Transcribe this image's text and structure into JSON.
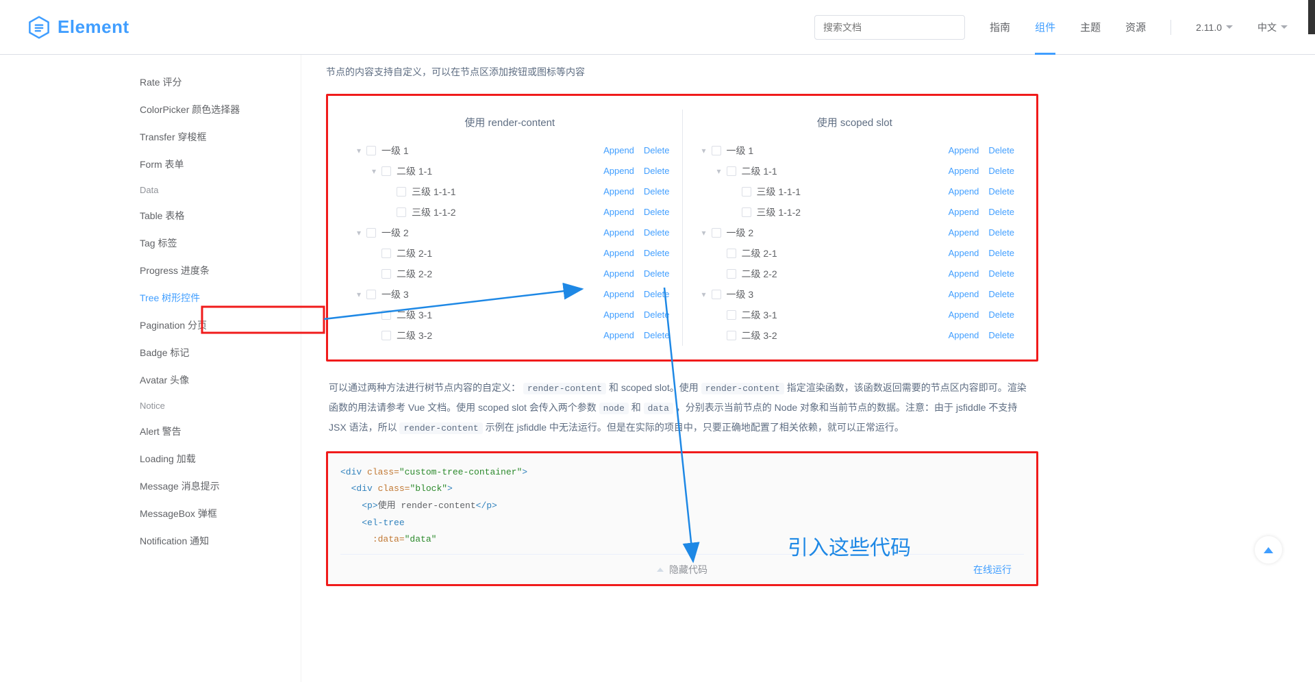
{
  "header": {
    "logo_text": "Element",
    "search_placeholder": "搜索文档",
    "nav": {
      "guide": "指南",
      "component": "组件",
      "theme": "主题",
      "resource": "资源"
    },
    "version": "2.11.0",
    "lang": "中文"
  },
  "sidebar": {
    "items": [
      {
        "label": "Rate 评分",
        "type": "item"
      },
      {
        "label": "ColorPicker 颜色选择器",
        "type": "item"
      },
      {
        "label": "Transfer 穿梭框",
        "type": "item"
      },
      {
        "label": "Form 表单",
        "type": "item"
      },
      {
        "label": "Data",
        "type": "cat"
      },
      {
        "label": "Table 表格",
        "type": "item"
      },
      {
        "label": "Tag 标签",
        "type": "item"
      },
      {
        "label": "Progress 进度条",
        "type": "item"
      },
      {
        "label": "Tree 树形控件",
        "type": "item",
        "active": true
      },
      {
        "label": "Pagination 分页",
        "type": "item"
      },
      {
        "label": "Badge 标记",
        "type": "item"
      },
      {
        "label": "Avatar 头像",
        "type": "item"
      },
      {
        "label": "Notice",
        "type": "cat"
      },
      {
        "label": "Alert 警告",
        "type": "item"
      },
      {
        "label": "Loading 加载",
        "type": "item"
      },
      {
        "label": "Message 消息提示",
        "type": "item"
      },
      {
        "label": "MessageBox 弹框",
        "type": "item"
      },
      {
        "label": "Notification 通知",
        "type": "item"
      }
    ]
  },
  "annotation": {
    "intro_code_text": "引入这些代码"
  },
  "demo": {
    "intro": "节点的内容支持自定义，可以在节点区添加按钮或图标等内容",
    "left_title": "使用 render-content",
    "right_title": "使用 scoped slot",
    "append": "Append",
    "delete": "Delete",
    "tree": [
      {
        "label": "一级 1",
        "depth": 0,
        "expanded": true
      },
      {
        "label": "二级 1-1",
        "depth": 1,
        "expanded": true
      },
      {
        "label": "三级 1-1-1",
        "depth": 2,
        "expanded": false,
        "leaf": true
      },
      {
        "label": "三级 1-1-2",
        "depth": 2,
        "expanded": false,
        "leaf": true
      },
      {
        "label": "一级 2",
        "depth": 0,
        "expanded": true
      },
      {
        "label": "二级 2-1",
        "depth": 1,
        "expanded": false,
        "leaf": true
      },
      {
        "label": "二级 2-2",
        "depth": 1,
        "expanded": false,
        "leaf": true
      },
      {
        "label": "一级 3",
        "depth": 0,
        "expanded": true
      },
      {
        "label": "二级 3-1",
        "depth": 1,
        "expanded": false,
        "leaf": true
      },
      {
        "label": "二级 3-2",
        "depth": 1,
        "expanded": false,
        "leaf": true
      }
    ],
    "desc_parts": [
      "可以通过两种方法进行树节点内容的自定义：",
      "和 scoped slot。使用",
      "指定渲染函数，该函数返回需要的节点区内容即可。渲染函数的用法请参考 Vue 文档。使用 scoped slot 会传入两个参数",
      "和",
      "，分别表示当前节点的 Node 对象和当前节点的数据。注意：由于 jsfiddle 不支持 JSX 语法，所以",
      "示例在 jsfiddle 中无法运行。但是在实际的项目中，只要正确地配置了相关依赖，就可以正常运行。"
    ],
    "desc_codes": {
      "rc1": "render-content",
      "rc2": "render-content",
      "node": "node",
      "data": "data",
      "rc3": "render-content"
    }
  },
  "code": {
    "l1_open": "<div ",
    "l1_attr": "class=",
    "l1_val": "\"custom-tree-container\"",
    "l1_close": ">",
    "l2_open": "<div ",
    "l2_attr": "class=",
    "l2_val": "\"block\"",
    "l2_close": ">",
    "l3_open": "<p>",
    "l3_text": "使用 render-content",
    "l3_close": "</p>",
    "l4": "<el-tree",
    "l5_attr": ":data=",
    "l5_val": "\"data\""
  },
  "code_toolbar": {
    "hide": "隐藏代码",
    "run": "在线运行"
  }
}
